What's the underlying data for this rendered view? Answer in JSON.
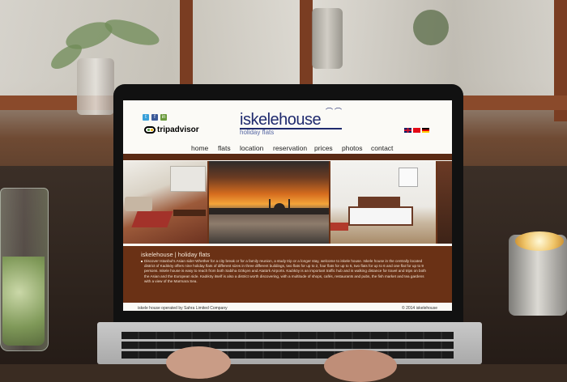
{
  "site": {
    "logo_word": "iskelehouse",
    "logo_sub": "holiday flats",
    "tripadvisor": "tripadvisor",
    "nav": [
      "home",
      "flats",
      "location",
      "reservation",
      "prices",
      "photos",
      "contact"
    ],
    "desc_title": "iskelehouse | holiday flats",
    "desc_text": "Discover Istanbul's Asian side! Whether for a city break or for a family reunion, a study trip or a longer stay, welcome to iskele house. Iskele house in the centrally located district of Kadıköy offers nine holiday flats of different sizes in three different buildings, two flats for up to 2, four flats for up to 5, two flats for up to 6 and one flat for up to 9 persons. Iskele house is easy to reach from both Sabiha Gökçen and Atatürk Airports. Kadıköy is an important traffic hub and is walking distance for travel and trips on both the Asian and the European side. Kadıköy itself is also a district worth discovering, with a multitude of shops, cafés, restaurants and pubs, the fish market and tea gardens with a view of the Marmara Sea.",
    "footer_left": "iskele house operated by Sahra Limited Company",
    "footer_right": "© 2014 iskelehouse"
  },
  "icons": {
    "social": [
      "twitter-icon",
      "facebook-icon",
      "linkedin-icon"
    ],
    "flags": [
      "uk-flag",
      "turkey-flag",
      "germany-flag"
    ]
  },
  "colors": {
    "brand_navy": "#1f2a6e",
    "brown_band": "#6a3115",
    "twitter": "#3aa0d9",
    "facebook": "#3b5998",
    "linkedin": "#6a9a3c"
  }
}
